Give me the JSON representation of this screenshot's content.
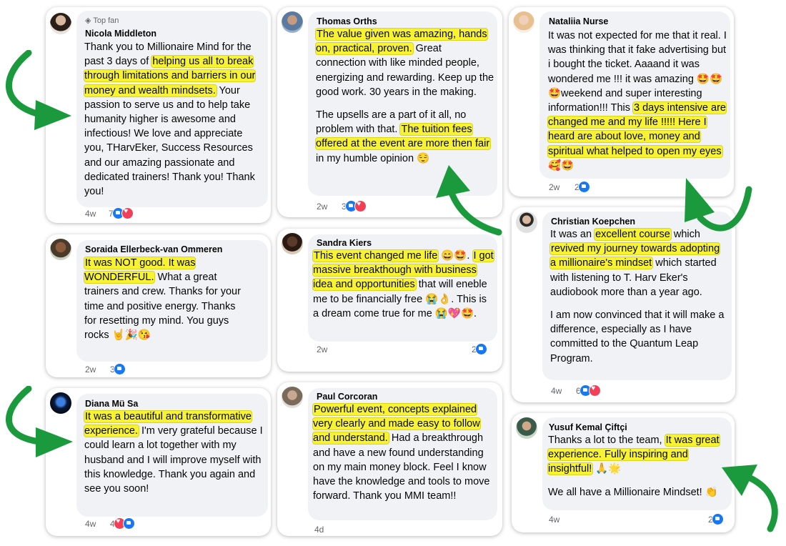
{
  "cards": [
    {
      "author": "Nicola Middleton",
      "badge": "Top fan",
      "time": "4w",
      "reaction_count": "7",
      "segments": [
        {
          "t": "Thank you to Millionaire Mind for the past 3 days of "
        },
        {
          "t": "helping us all to break through limitations and barriers in our money and wealth mindsets.",
          "h": true
        },
        {
          "t": " Your passion to serve us and to help take humanity higher is awesome and infectious! We love and appreciate you, THarvEker, Success Resources and our amazing passionate and dedicated trainers! Thank you! Thank you!"
        }
      ]
    },
    {
      "author": "Thomas Orths",
      "time": "2w",
      "reaction_count": "3",
      "segments": [
        {
          "t": "The value given was amazing, hands on, practical, proven.",
          "h": true
        },
        {
          "t": " Great connection with like minded people, energizing and rewarding. Keep up the good work. 30 years in the making."
        }
      ],
      "segments2": [
        {
          "t": "The upsells are a part of it all, no problem with that. "
        },
        {
          "t": "The tuition fees offered at the event are more then fair",
          "h": true
        },
        {
          "t": " in my humble opinion 😌"
        }
      ]
    },
    {
      "author": "Nataliia Nurse",
      "time": "2w",
      "reaction_count": "2",
      "segments": [
        {
          "t": "It was not expected for me that it real. I was thinking that it fake advertising but i bought the ticket. Aaaand it was wondered me !!! it was amazing 🤩🤩🤩weekend and super interesting information!!! This "
        },
        {
          "t": "3 days intensive are changed me and my life !!!!! Here I heard are about love, money and spiritual what helped to open my eyes",
          "h": true
        },
        {
          "t": " 🥰🤩"
        }
      ]
    },
    {
      "author": "Soraida Ellerbeck-van Ommeren",
      "time": "2w",
      "reaction_count": "3",
      "segments": [
        {
          "t": "It was NOT good. It was WONDERFUL.",
          "h": true
        },
        {
          "t": " What a great trainers and crew. Thanks for your time and positive energy. Thanks for resetting my mind. You guys rocks 🤘🎉😘"
        }
      ]
    },
    {
      "author": "Sandra Kiers",
      "time": "2w",
      "reaction_count": "2",
      "segments": [
        {
          "t": "This event changed me life",
          "h": true
        },
        {
          "t": " 😄🤩. "
        },
        {
          "t": "I got massive breakthough with business idea and opportunities",
          "h": true
        },
        {
          "t": " that will eneble me to be financially free 😭👌. This is a dream come true for me 😭💖🤩."
        }
      ]
    },
    {
      "author": "Christian Koepchen",
      "time": "4w",
      "reaction_count": "6",
      "segments": [
        {
          "t": "It was an "
        },
        {
          "t": "excellent course",
          "h": true
        },
        {
          "t": " which "
        },
        {
          "t": "revived my journey towards adopting a millionaire's mindset",
          "h": true
        },
        {
          "t": " which started with listening to T. Harv Eker's audiobook more than a year ago."
        }
      ],
      "segments2": [
        {
          "t": "I am now convinced that it will make a difference, especially as I have committed to the Quantum Leap Program."
        }
      ]
    },
    {
      "author": "Diana Mü Sa",
      "time": "4w",
      "reaction_count": "4",
      "segments": [
        {
          "t": "It was a beautiful and transformative experience.",
          "h": true
        },
        {
          "t": " I'm very grateful because I could learn a lot together with my husband and I will improve myself with this knowledge. Thank you again and see you soon!"
        }
      ]
    },
    {
      "author": "Paul Corcoran",
      "time": "4d",
      "reaction_count": "",
      "segments": [
        {
          "t": "Powerful event, concepts explained very clearly and made easy to follow and understand.",
          "h": true
        },
        {
          "t": " Had a breakthrough and have a new found understanding on my main money block. Feel I know have the knowledge and tools to move forward. Thank you MMI team!!"
        }
      ]
    },
    {
      "author": "Yusuf Kemal Çiftçi",
      "time": "4w",
      "reaction_count": "2",
      "segments": [
        {
          "t": "Thanks a lot to the team, "
        },
        {
          "t": "It was great experience. Fully inspiring and insightful!",
          "h": true
        },
        {
          "t": " 🙏🌟"
        }
      ],
      "segments2": [
        {
          "t": "We all have a Millionaire Mindset! 👏"
        }
      ]
    }
  ],
  "colors": {
    "highlight": "#f7f332",
    "arrow": "#1a9a3c",
    "like": "#1877f2",
    "heart": "#f33e58",
    "bubble": "#f0f2f5"
  },
  "icons": [
    "top-fan-diamond-icon",
    "like-reaction-icon",
    "love-reaction-icon",
    "curved-arrow-icon"
  ]
}
